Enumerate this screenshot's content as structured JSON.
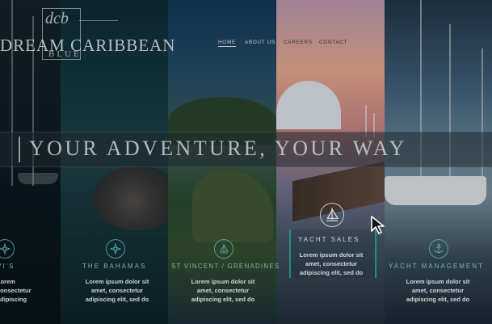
{
  "brand": {
    "monogram": "dcb",
    "name": "DREAM CARIBBEAN",
    "sub": "BLUE"
  },
  "nav": {
    "home": "HOME",
    "about": "ABOUT US",
    "careers": "CAREERS",
    "contact": "CONTACT"
  },
  "hero": {
    "headline": "YOUR ADVENTURE, YOUR WAY"
  },
  "destinations": [
    {
      "title": "VI'S",
      "body_lines": [
        "Lorem",
        "consectetur",
        "adipiscing"
      ]
    },
    {
      "title": "THE BAHAMAS",
      "body_lines": [
        "Lorem ipsum dolor sit",
        "amet, consectetur",
        "adipiscing elit, sed do"
      ]
    },
    {
      "title": "ST VINCENT / GRENADINES",
      "body_lines": [
        "Lorem ipsum dolor sit",
        "amet, consectetur",
        "adipiscing elit, sed do"
      ]
    },
    {
      "title": "YACHT SALES",
      "body_lines": [
        "Lorem ipsum dolor sit",
        "amet, consectetur",
        "adipiscing elit, sed do"
      ]
    },
    {
      "title": "YACHT MANAGEMENT",
      "body_lines": [
        "Lorem ipsum dolor sit",
        "amet, consectetur",
        "adipiscing elit, sed do"
      ]
    }
  ],
  "icons": {
    "compass": "compass-icon",
    "sail": "sailboat-icon",
    "anchor": "anchor-icon",
    "cursor": "mouse-pointer-icon"
  },
  "colors": {
    "accent": "#2fa8a0",
    "text": "#e1e6e6"
  }
}
